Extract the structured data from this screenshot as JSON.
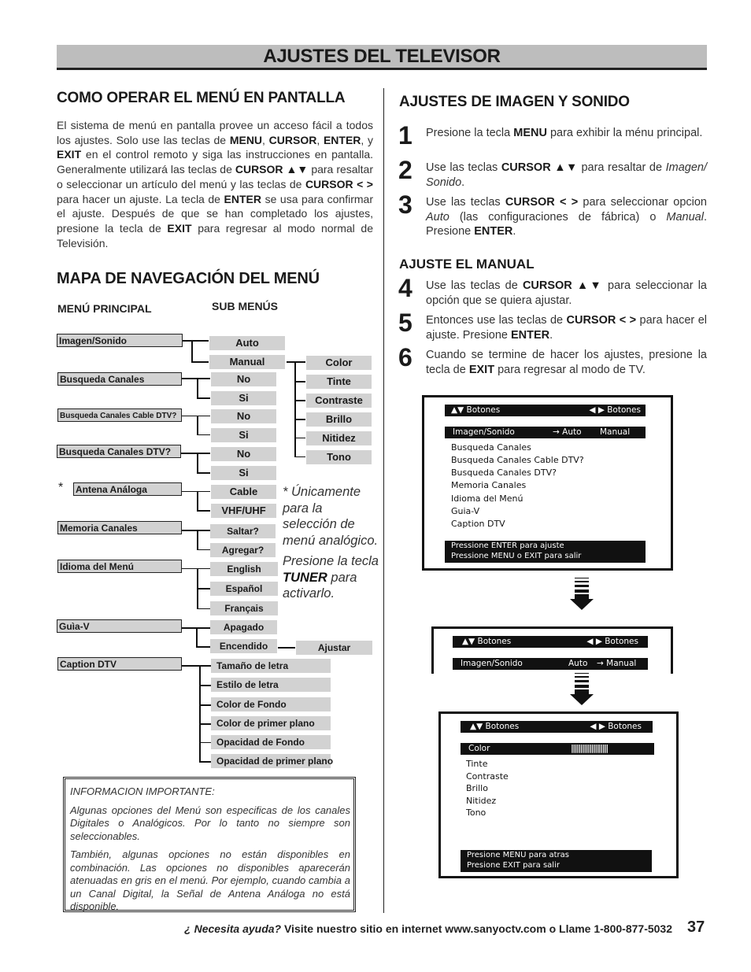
{
  "header": {
    "title": "AJUSTES DEL TELEVISOR"
  },
  "left": {
    "section1": {
      "title": "COMO OPERAR EL MENÚ EN PANTALLA",
      "p": [
        "El sistema de menú en pantalla provee un acceso fácil a todos los ajustes. Solo use las teclas de ",
        "MENU",
        ", ",
        "CURSOR",
        ", ",
        "ENTER",
        ", y ",
        "EXIT",
        " en el control remoto y siga las instrucciones en pantalla. Generalmente utilizará las teclas de ",
        "CURSOR ▲▼",
        " para resaltar o seleccionar un artículo del menú y las teclas de ",
        "CURSOR < >",
        " para hacer un ajuste. La tecla de ",
        "ENTER",
        " se usa para confirmar el ajuste. Después de que se han completado los ajustes, presione la tecla de ",
        "EXIT",
        " para regresar al modo normal de Televisión."
      ]
    },
    "section2": {
      "title": "MAPA DE NAVEGACIÓN DEL MENÚ",
      "col_main": "MENÚ PRINCIPAL",
      "col_sub": "SUB MENÚS"
    },
    "menu_map": {
      "main": [
        "Imagen/Sonido",
        "Busqueda Canales",
        "Busqueda Canales Cable DTV?",
        "Busqueda Canales DTV?",
        "Antena Análoga",
        "Memoria Canales",
        "Idioma del Menú",
        "Guìa-V",
        "Caption DTV"
      ],
      "asterisk": "*",
      "imagen_sub": [
        "Auto",
        "Manual"
      ],
      "manual_sub": [
        "Color",
        "Tinte",
        "Contraste",
        "Brillo",
        "Nitidez",
        "Tono"
      ],
      "busqueda_sub": [
        "No",
        "Si"
      ],
      "cable_dtv_sub": [
        "No",
        "Si"
      ],
      "dtv_sub": [
        "No",
        "Si"
      ],
      "antena_sub": [
        "Cable",
        "VHF/UHF"
      ],
      "memoria_sub": [
        "Saltar?",
        "Agregar?"
      ],
      "idioma_sub": [
        "English",
        "Español",
        "Français"
      ],
      "guia_sub": [
        "Apagado",
        "Encendido"
      ],
      "encendido_sub": [
        "Ajustar"
      ],
      "caption_sub": [
        "Tamaño de letra",
        "Estilo de letra",
        "Color de Fondo",
        "Color de primer plano",
        "Opacidad de Fondo",
        "Opacidad de primer plano"
      ]
    },
    "side_note": {
      "line1": "* Únicamente para la selección de menú analógico.",
      "line2a": "Presione la tecla ",
      "line2b": "TUNER",
      "line2c": " para activarlo."
    },
    "info": {
      "heading": "INFORMACION IMPORTANTE:",
      "p1": "Algunas opciones del Menú son especificas de los canales Digitales o Analógicos. Por lo tanto no siempre son seleccionables.",
      "p2": "También, algunas opciones no están disponibles en combinación. Las opciones no disponibles aparecerán atenuadas en gris en el menú. Por ejemplo, cuando cambia a un Canal Digital, la Señal de Antena Análoga no está disponible."
    }
  },
  "right": {
    "title": "AJUSTES DE IMAGEN Y SONIDO",
    "subtitle": "AJUSTE EL MANUAL",
    "steps": [
      {
        "n": "1",
        "parts": [
          "Presione la tecla ",
          "MENU",
          " para exhibir la ménu principal."
        ]
      },
      {
        "n": "2",
        "parts": [
          "Use las teclas ",
          "CURSOR ▲▼",
          " para resaltar de ",
          "Imagen/ Sonido",
          "."
        ]
      },
      {
        "n": "3",
        "parts": [
          "Use las teclas ",
          "CURSOR < >",
          " para seleccionar opcion ",
          "Auto",
          " (las configuraciones de fábrica) o ",
          "Manual",
          ". Presione ",
          "ENTER",
          "."
        ]
      },
      {
        "n": "4",
        "parts": [
          "Use las teclas de ",
          "CURSOR ▲▼",
          " para seleccionar la opción que se quiera ajustar."
        ]
      },
      {
        "n": "5",
        "parts": [
          "Entonces use las teclas de ",
          "CURSOR < >",
          " para hacer el ajuste. Presione ",
          "ENTER",
          "."
        ]
      },
      {
        "n": "6",
        "parts": [
          "Cuando se termine de hacer los ajustes, presione la tecla de ",
          "EXIT",
          " para regresar al modo de TV."
        ]
      }
    ],
    "screen1": {
      "bar_left": "▲▼ Botones",
      "bar_right": "◀ ▶ Botones",
      "selected": {
        "label": "Imagen/Sonido",
        "option1": "→ Auto",
        "option2": "Manual"
      },
      "items": [
        "Busqueda Canales",
        "Busqueda Canales Cable DTV?",
        "Busqueda Canales DTV?",
        "Memoria Canales",
        "Idioma del Menú",
        "Guia-V",
        "Caption DTV"
      ],
      "footer1": "Pressione ENTER para ajuste",
      "footer2": "Pressione MENU o EXIT para salir"
    },
    "screen2": {
      "bar_left": "▲▼ Botones",
      "bar_right": "◀ ▶ Botones",
      "selected": {
        "label": "Imagen/Sonido",
        "option1": "Auto",
        "option2": "→ Manual"
      }
    },
    "screen3": {
      "bar_left": "▲▼ Botones",
      "bar_right": "◀ ▶ Botones",
      "selected": {
        "label": "Color",
        "level_bar": "||||||||||||||||||||"
      },
      "items": [
        "Tinte",
        "Contraste",
        "Brillo",
        "Nitidez",
        "Tono"
      ],
      "footer1": "Presione MENU para atras",
      "footer2": "Presione EXIT para salir"
    }
  },
  "footer": {
    "help_question": "¿ Necesita ayuda?",
    "help_text": " Visite nuestro sitio en internet www.sanyoctv.com o Llame 1-800-877-5032",
    "page_number": "37"
  }
}
